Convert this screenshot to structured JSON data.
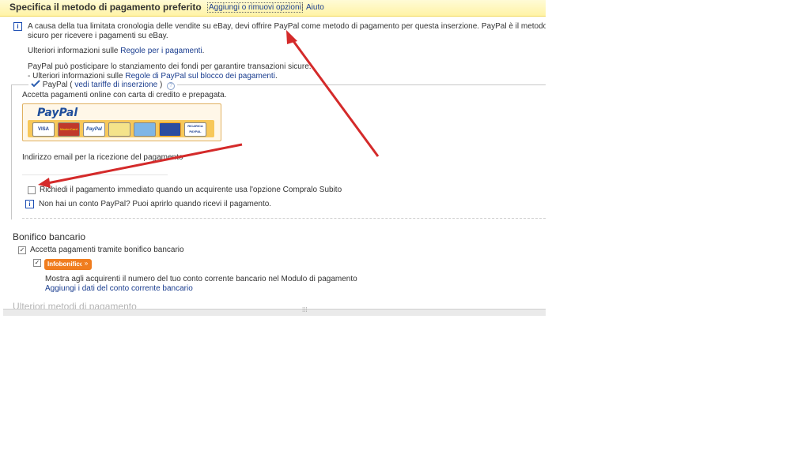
{
  "header": {
    "title": "Specifica il metodo di pagamento preferito",
    "options_link": "Aggiungi o rimuovi opzioni",
    "separator": "|",
    "help_link": "Aiuto"
  },
  "notice": {
    "line1": "A causa della tua limitata cronologia delle vendite su eBay, devi offrire PayPal come metodo di pagamento per questa inserzione. PayPal è il metodo pi",
    "line2": "sicuro per ricevere i pagamenti su eBay.",
    "more_info_prefix": "Ulteriori informazioni sulle ",
    "more_info_link": "Regole per i pagamenti",
    "more_info_suffix": ".",
    "hold_line": "PayPal può posticipare lo stanziamento dei fondi per garantire transazioni sicure.",
    "hold_prefix": "- Ulteriori informazioni sulle ",
    "hold_link": "Regole di PayPal sul blocco dei pagamenti",
    "hold_suffix": "."
  },
  "paypal": {
    "legend_label": "PayPal",
    "legend_open": " ( ",
    "fees_link": "vedi tariffe di inserzione",
    "legend_close": " )",
    "description": "Accetta pagamenti online con carta di credito e prepagata.",
    "logo_text": "PayPal",
    "cards": [
      "VISA",
      "MasterCard",
      "PayPal",
      "",
      "",
      "",
      "RICARICA PAYPAL"
    ],
    "email_label": "Indirizzo email per la ricezione del pagamento",
    "email_value": "",
    "immediate_payment_label": "Richiedi il pagamento immediato quando un acquirente usa l'opzione Compralo Subito",
    "immediate_payment_checked": false,
    "no_account_text": "Non hai un conto PayPal? Puoi aprirlo quando ricevi il pagamento."
  },
  "bonifico": {
    "title": "Bonifico bancario",
    "accept_label": "Accetta pagamenti tramite bonifico bancario",
    "accept_checked": true,
    "info_checked": true,
    "badge": "Infobonifico",
    "show_account_text": "Mostra agli acquirenti il numero del tuo conto corrente bancario nel Modulo di pagamento",
    "add_bank_link": "Aggiungi i dati del conto corrente bancario"
  },
  "more_methods": {
    "title": "Ulteriori metodi di pagamento"
  },
  "colors": {
    "header_bg": "#fff3a6",
    "link": "#1a3d8f",
    "info_icon": "#1b4db3",
    "badge_bg": "#f07d1f",
    "annotation_arrow": "#d42a2a"
  },
  "icons": {
    "info": "info-icon",
    "check": "checkmark-icon",
    "help": "help-icon",
    "badge_arrow": "double-chevron-right-icon"
  }
}
